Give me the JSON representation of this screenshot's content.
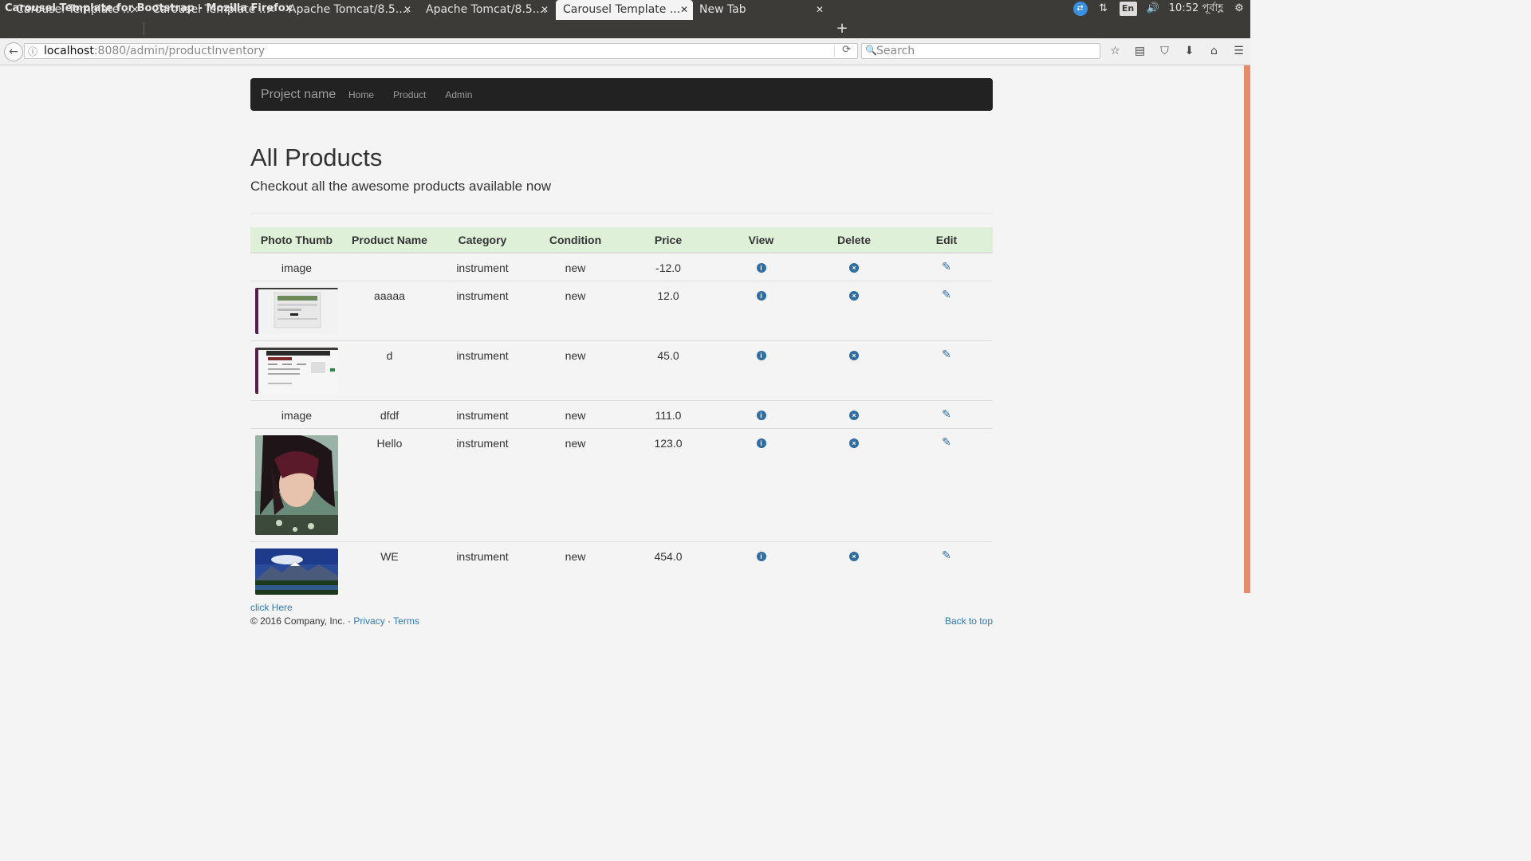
{
  "window": {
    "title": "Carousel Template for Bootstrap - Mozilla Firefox",
    "tray": {
      "lang": "En",
      "time": "10:52 পূর্বাহ্ণ"
    }
  },
  "tabs": [
    {
      "label": "Carousel Template ...",
      "active": false
    },
    {
      "label": "Carousel Template ...",
      "active": false
    },
    {
      "label": "Apache Tomcat/8.5....",
      "active": false
    },
    {
      "label": "Apache Tomcat/8.5....",
      "active": false
    },
    {
      "label": "Carousel Template ...",
      "active": true
    },
    {
      "label": "New Tab",
      "active": false
    }
  ],
  "browser": {
    "url_host": "localhost",
    "url_rest": ":8080/admin/productInventory",
    "search_placeholder": "Search"
  },
  "site": {
    "brand": "Project name",
    "nav": {
      "home": "Home",
      "product": "Product",
      "admin": "Admin"
    }
  },
  "page": {
    "title": "All Products",
    "lead": "Checkout all the awesome products available now"
  },
  "table": {
    "headers": {
      "photo": "Photo Thumb",
      "name": "Product Name",
      "category": "Category",
      "condition": "Condition",
      "price": "Price",
      "view": "View",
      "delete": "Delete",
      "edit": "Edit"
    },
    "rows": [
      {
        "photo_alt": "image",
        "name": "",
        "category": "instrument",
        "condition": "new",
        "price": "-12.0"
      },
      {
        "photo_alt": "",
        "name": "aaaaa",
        "category": "instrument",
        "condition": "new",
        "price": "12.0"
      },
      {
        "photo_alt": "",
        "name": "d",
        "category": "instrument",
        "condition": "new",
        "price": "45.0"
      },
      {
        "photo_alt": "image",
        "name": "dfdf",
        "category": "instrument",
        "condition": "new",
        "price": "111.0"
      },
      {
        "photo_alt": "",
        "name": "Hello",
        "category": "instrument",
        "condition": "new",
        "price": "123.0"
      },
      {
        "photo_alt": "",
        "name": "WE",
        "category": "instrument",
        "condition": "new",
        "price": "454.0"
      }
    ]
  },
  "footer": {
    "click_here": "click Here",
    "copyright": "© 2016 Company, Inc. ·",
    "privacy": "Privacy",
    "dot": "·",
    "terms": "Terms",
    "back_to_top": "Back to top"
  },
  "colors": {
    "navbar_bg": "#222222",
    "table_header_bg": "#dff0d8",
    "link": "#337ab7",
    "page_bg": "#f4f4f4"
  }
}
